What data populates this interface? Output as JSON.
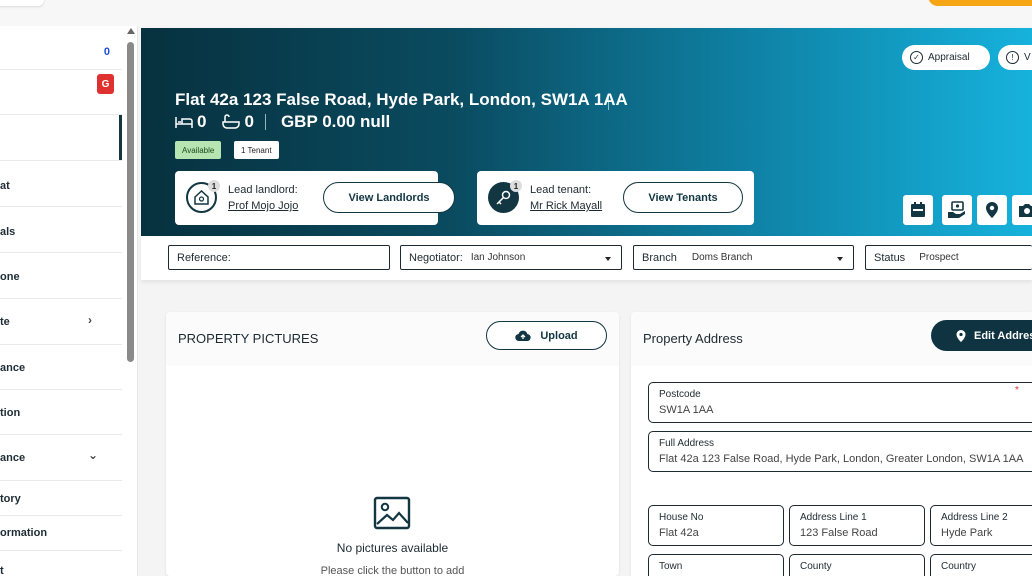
{
  "sidebar": {
    "top_count": "0",
    "alert_badge": "G",
    "items": [
      {
        "label": "at"
      },
      {
        "label": "als"
      },
      {
        "label": "one"
      },
      {
        "label": "te"
      },
      {
        "label": "ance"
      },
      {
        "label": "tion"
      },
      {
        "label": "ance"
      },
      {
        "label": "tory"
      },
      {
        "label": "ormation"
      },
      {
        "label": "t"
      }
    ]
  },
  "property": {
    "address": "Flat 42a 123 False Road, Hyde Park, London, SW1A 1AA",
    "bedrooms": "0",
    "bathrooms": "0",
    "price": "GBP 0.00 null",
    "status_badge": "Available",
    "tenant_badge": "1 Tenant"
  },
  "hero_actions": {
    "appraisal": "Appraisal",
    "second_pill_initial": "V"
  },
  "lead_landlord": {
    "count": "1",
    "label": "Lead landlord:",
    "name": "Prof Mojo Jojo",
    "button": "View Landlords"
  },
  "lead_tenant": {
    "count": "1",
    "label": "Lead tenant:",
    "name": "Mr Rick Mayall",
    "button": "View Tenants"
  },
  "filters": {
    "reference_label": "Reference:",
    "negotiator_label": "Negotiator:",
    "negotiator_value": "Ian Johnson",
    "branch_label": "Branch",
    "branch_value": "Doms Branch",
    "status_label": "Status",
    "status_value": "Prospect"
  },
  "pictures": {
    "title": "PROPERTY PICTURES",
    "upload": "Upload",
    "empty_title": "No pictures available",
    "empty_sub": "Please click the button to add"
  },
  "address_panel": {
    "title": "Property Address",
    "edit": "Edit Address",
    "postcode_label": "Postcode",
    "postcode_value": "SW1A 1AA",
    "required_mark": "*",
    "full_label": "Full Address",
    "full_value": "Flat 42a 123 False Road, Hyde Park, London, Greater London, SW1A 1AA",
    "house_label": "House No",
    "house_value": "Flat 42a",
    "line1_label": "Address Line 1",
    "line1_value": "123 False Road",
    "line2_label": "Address Line 2",
    "line2_value": "Hyde Park",
    "town_label": "Town",
    "county_label": "County",
    "country_label": "Country"
  },
  "colors": {
    "primary": "#123642",
    "hero_gradient_start": "#07313f",
    "hero_gradient_end": "#16b2dc",
    "accent_orange": "#f6a515",
    "alert_red": "#e03131",
    "available_green": "#b6e5b1"
  }
}
